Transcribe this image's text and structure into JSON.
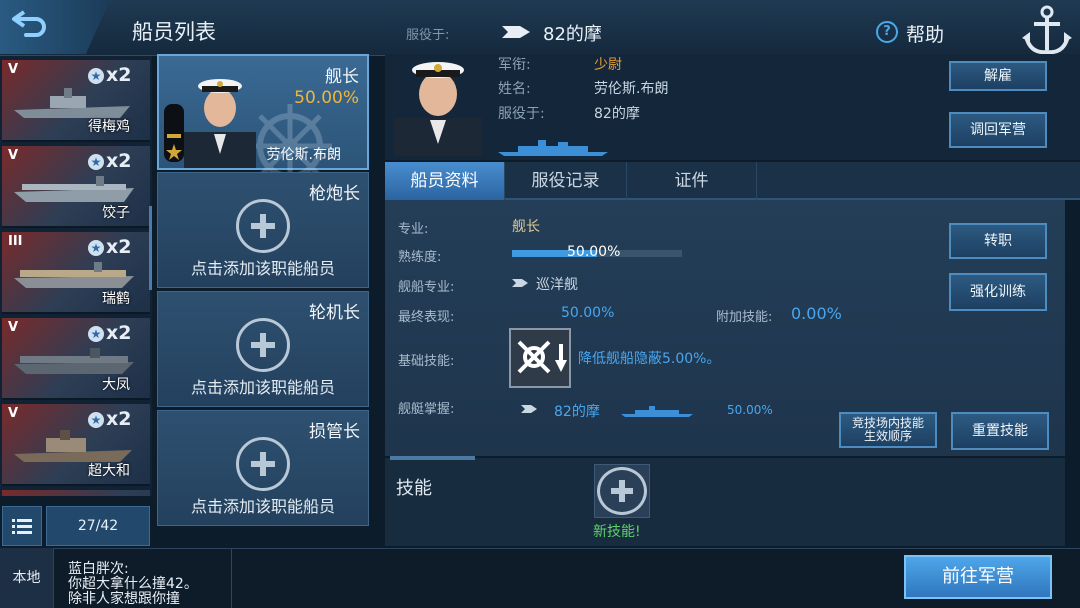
{
  "header": {
    "title": "船员列表",
    "serve_label": "服役于:",
    "serve_ship": "82的摩",
    "help_label": "帮助",
    "help_icon": "?"
  },
  "ship_list": {
    "ships": [
      {
        "tier": "V",
        "name": "得梅鸡",
        "count": "x2",
        "star": "★"
      },
      {
        "tier": "V",
        "name": "饺子",
        "count": "x2",
        "star": "★"
      },
      {
        "tier": "III",
        "name": "瑞鹤",
        "count": "x2",
        "star": "★"
      },
      {
        "tier": "V",
        "name": "大凤",
        "count": "x2",
        "star": "★"
      },
      {
        "tier": "V",
        "name": "超大和",
        "count": "x2",
        "star": "★"
      }
    ],
    "count": "27/42"
  },
  "crew_slots": {
    "captain": {
      "role": "舰长",
      "percent": "50.00%",
      "name": "劳伦斯.布朗"
    },
    "gunner": {
      "role": "枪炮长",
      "hint": "点击添加该职能船员"
    },
    "engineer": {
      "role": "轮机长",
      "hint": "点击添加该职能船员"
    },
    "damage": {
      "role": "损管长",
      "hint": "点击添加该职能船员"
    }
  },
  "officer": {
    "rank_label": "军衔:",
    "rank": "少尉",
    "name_label": "姓名:",
    "name": "劳伦斯.布朗",
    "serve_label": "服役于:",
    "serve": "82的摩"
  },
  "buttons": {
    "dismiss": "解雇",
    "recall": "调回军营",
    "transfer": "转职",
    "train": "强化训练",
    "arena_order_1": "竞技场内技能",
    "arena_order_2": "生效顺序",
    "reset": "重置技能",
    "goto_barracks": "前往军营"
  },
  "tabs": [
    "船员资料",
    "服役记录",
    "证件"
  ],
  "details": {
    "spec_label": "专业:",
    "spec": "舰长",
    "prof_label": "熟练度:",
    "prof": "50.00%",
    "prof_fraction": 0.5,
    "ship_spec_label": "舰船专业:",
    "ship_spec": "巡洋舰",
    "final_label": "最终表现:",
    "final": "50.00%",
    "extra_label": "附加技能:",
    "extra": "0.00%",
    "base_skill_label": "基础技能:",
    "base_skill": "降低舰船隐蔽5.00%。",
    "mastery_label": "舰艇掌握:",
    "mastery_ship": "82的摩",
    "mastery_pct": "50.00%"
  },
  "skills": {
    "label": "技能",
    "new_skill": "新技能!"
  },
  "chat": {
    "channel": "本地",
    "line1": "蓝白胖次:",
    "line2": "你超大拿什么撞42。",
    "line3": "除非人家想跟你撞"
  },
  "colors": {
    "accent": "#48a6f0",
    "rank": "#e8a030",
    "captain_pct": "#f0b63a",
    "new_skill": "#5fd06a"
  }
}
